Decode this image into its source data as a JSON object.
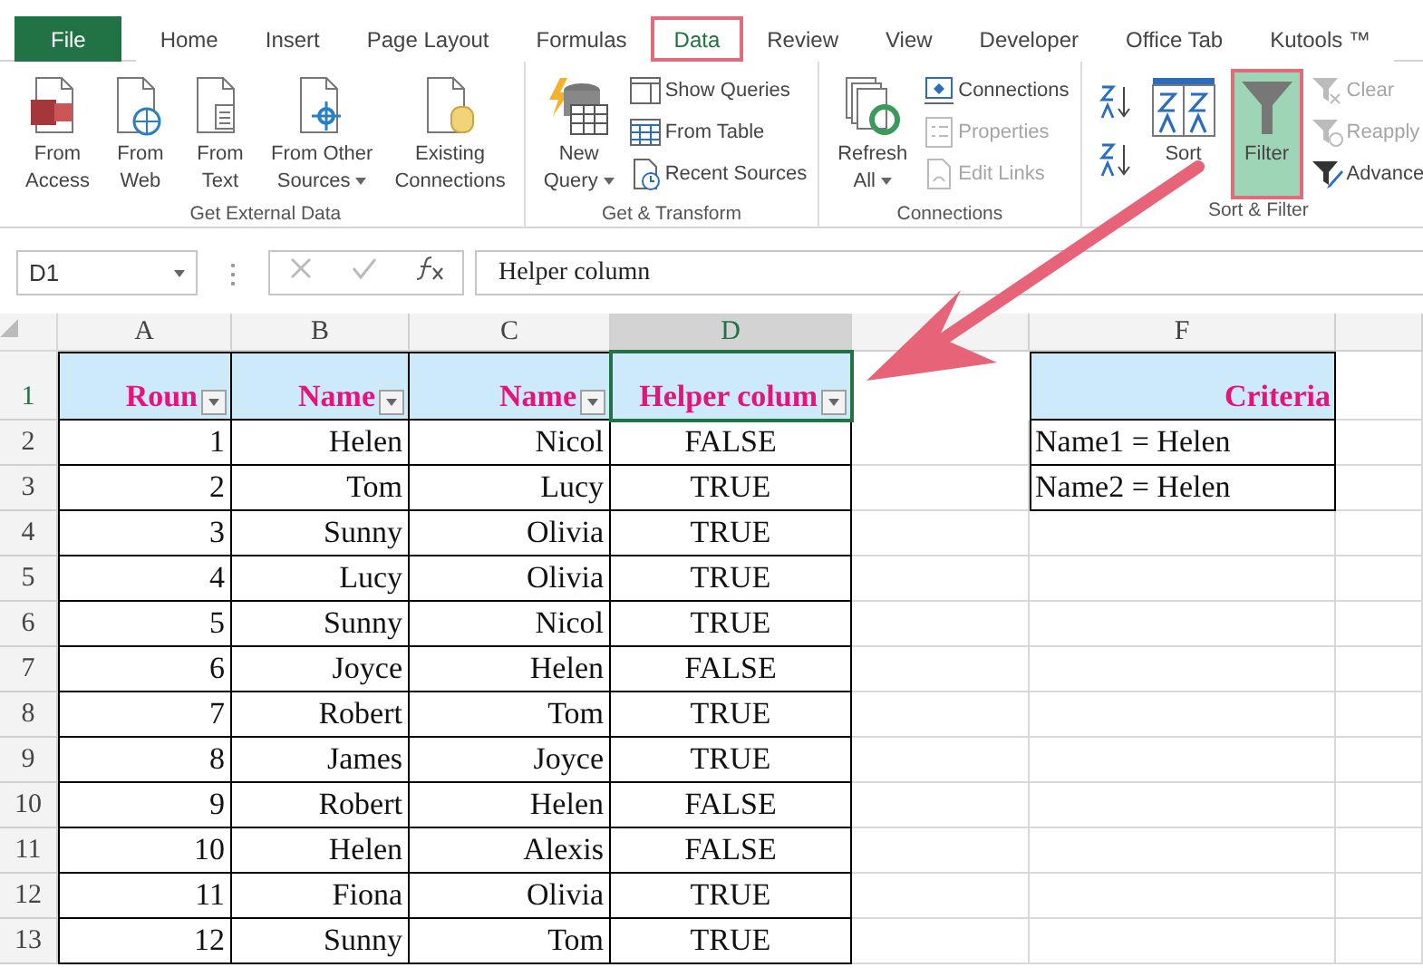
{
  "tabs": [
    {
      "label": "File",
      "kind": "file",
      "selected": false,
      "highlighted": false
    },
    {
      "label": "Home",
      "kind": "tab",
      "selected": false,
      "highlighted": false
    },
    {
      "label": "Insert",
      "kind": "tab",
      "selected": false,
      "highlighted": false
    },
    {
      "label": "Page Layout",
      "kind": "tab",
      "selected": false,
      "highlighted": false
    },
    {
      "label": "Formulas",
      "kind": "tab",
      "selected": false,
      "highlighted": false
    },
    {
      "label": "Data",
      "kind": "tab",
      "selected": true,
      "highlighted": true
    },
    {
      "label": "Review",
      "kind": "tab",
      "selected": false,
      "highlighted": false
    },
    {
      "label": "View",
      "kind": "tab",
      "selected": false,
      "highlighted": false
    },
    {
      "label": "Developer",
      "kind": "tab",
      "selected": false,
      "highlighted": false
    },
    {
      "label": "Office Tab",
      "kind": "tab",
      "selected": false,
      "highlighted": false
    },
    {
      "label": "Kutools ™",
      "kind": "tab",
      "selected": false,
      "highlighted": false
    }
  ],
  "ribbon": [
    {
      "label": "Get External Data",
      "items": [
        {
          "kind": "large",
          "lines": [
            "From",
            "Access"
          ],
          "dropdown": false
        },
        {
          "kind": "large",
          "lines": [
            "From",
            "Web"
          ],
          "dropdown": false
        },
        {
          "kind": "large",
          "lines": [
            "From",
            "Text"
          ],
          "dropdown": false
        },
        {
          "kind": "large",
          "lines": [
            "From Other",
            "Sources"
          ],
          "dropdown": true
        },
        {
          "kind": "large",
          "lines": [
            "Existing",
            "Connections"
          ],
          "dropdown": false
        }
      ]
    },
    {
      "label": "Get & Transform",
      "items": [
        {
          "kind": "large",
          "lines": [
            "New",
            "Query"
          ],
          "dropdown": true
        },
        {
          "kind": "stack",
          "entries": [
            {
              "label": "Show Queries",
              "disabled": false
            },
            {
              "label": "From Table",
              "disabled": false
            },
            {
              "label": "Recent Sources",
              "disabled": false
            }
          ]
        }
      ]
    },
    {
      "label": "Connections",
      "items": [
        {
          "kind": "large",
          "lines": [
            "Refresh",
            "All"
          ],
          "dropdown": true
        },
        {
          "kind": "stack",
          "entries": [
            {
              "label": "Connections",
              "disabled": false
            },
            {
              "label": "Properties",
              "disabled": true
            },
            {
              "label": "Edit Links",
              "disabled": true
            }
          ]
        }
      ]
    },
    {
      "label": "Sort & Filter",
      "items": [
        {
          "kind": "sorters"
        },
        {
          "kind": "large",
          "lines": [
            "Sort"
          ],
          "dropdown": false
        },
        {
          "kind": "large",
          "lines": [
            "Filter"
          ],
          "dropdown": false,
          "selected": true,
          "highlighted": true
        },
        {
          "kind": "stack",
          "entries": [
            {
              "label": "Clear",
              "disabled": true
            },
            {
              "label": "Reapply",
              "disabled": true
            },
            {
              "label": "Advance",
              "disabled": false
            }
          ]
        }
      ]
    }
  ],
  "formula_bar": {
    "name_box": "D1",
    "formula": "Helper column"
  },
  "sheet": {
    "columns": [
      {
        "label": "A",
        "selected": false
      },
      {
        "label": "B",
        "selected": false
      },
      {
        "label": "C",
        "selected": false
      },
      {
        "label": "D",
        "selected": true
      },
      {
        "selected": false
      },
      {
        "label": "F",
        "selected": false
      }
    ],
    "row_numbers": [
      {
        "label": "1",
        "selected": true
      },
      {
        "label": "2",
        "selected": false
      },
      {
        "label": "3",
        "selected": false
      },
      {
        "label": "4",
        "selected": false
      },
      {
        "label": "5",
        "selected": false
      },
      {
        "label": "6",
        "selected": false
      },
      {
        "label": "7",
        "selected": false
      },
      {
        "label": "8",
        "selected": false
      },
      {
        "label": "9",
        "selected": false
      },
      {
        "label": "10",
        "selected": false
      },
      {
        "label": "11",
        "selected": false
      },
      {
        "label": "12",
        "selected": false
      },
      {
        "label": "13",
        "selected": false
      }
    ],
    "data_table": {
      "headers": [
        {
          "text": "Roun",
          "filter": true,
          "selected": false
        },
        {
          "text": "Name",
          "filter": true,
          "selected": false
        },
        {
          "text": "Name",
          "filter": true,
          "selected": false
        },
        {
          "text": "Helper colum",
          "filter": true,
          "selected": true
        }
      ],
      "rows": [
        [
          "1",
          "Helen",
          "Nicol",
          "FALSE"
        ],
        [
          "2",
          "Tom",
          "Lucy",
          "TRUE"
        ],
        [
          "3",
          "Sunny",
          "Olivia",
          "TRUE"
        ],
        [
          "4",
          "Lucy",
          "Olivia",
          "TRUE"
        ],
        [
          "5",
          "Sunny",
          "Nicol",
          "TRUE"
        ],
        [
          "6",
          "Joyce",
          "Helen",
          "FALSE"
        ],
        [
          "7",
          "Robert",
          "Tom",
          "TRUE"
        ],
        [
          "8",
          "James",
          "Joyce",
          "TRUE"
        ],
        [
          "9",
          "Robert",
          "Helen",
          "FALSE"
        ],
        [
          "10",
          "Helen",
          "Alexis",
          "FALSE"
        ],
        [
          "11",
          "Fiona",
          "Olivia",
          "TRUE"
        ],
        [
          "12",
          "Sunny",
          "Tom",
          "TRUE"
        ]
      ]
    },
    "criteria": {
      "header": {
        "text": "Criteria",
        "filter": false,
        "selected": false
      },
      "rows": [
        "Name1 = Helen",
        "Name2 = Helen"
      ]
    }
  }
}
